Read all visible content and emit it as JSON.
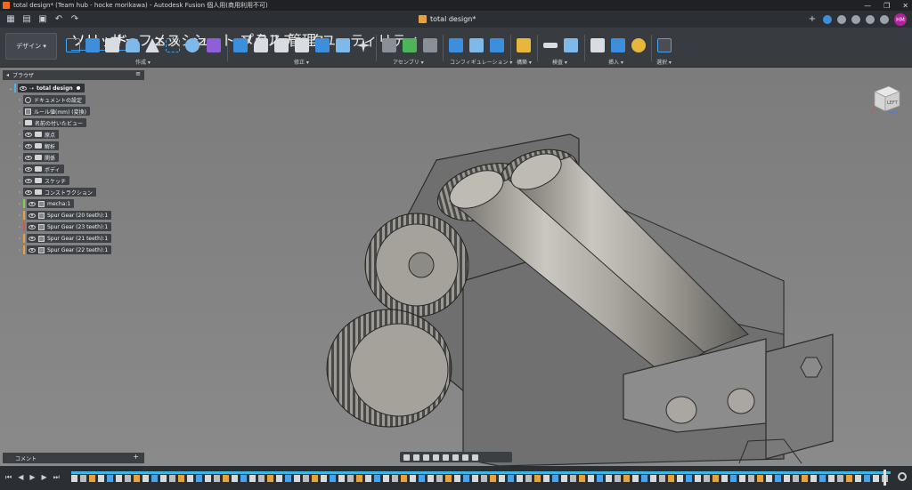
{
  "window": {
    "title": "total design* (Team hub - hocke morikawa) - Autodesk Fusion 個人用(商用利用不可)"
  },
  "document_tab": {
    "label": "total design*"
  },
  "user": {
    "initials": "HM",
    "avatar_color": "#b0249a"
  },
  "ribbon": {
    "workspace_label": "デザイン ▾",
    "tabs": [
      "ソリッド",
      "サーフェス",
      "メッシュ",
      "シート メタル",
      "プラスチック",
      "管理",
      "ユーティリティ"
    ],
    "active_tab": "ソリッド",
    "groups": [
      "作成 ▾",
      "修正 ▾",
      "アセンブリ ▾",
      "コンフィギュレーション ▾",
      "構築 ▾",
      "検査 ▾",
      "挿入 ▾",
      "選択 ▾"
    ]
  },
  "browser": {
    "title": "ブラウザ",
    "root": "total design",
    "items": [
      {
        "label": "ドキュメントの設定",
        "icon": "gear-icon"
      },
      {
        "label": "ルール値(mm) (変換)",
        "icon": "units-icon"
      },
      {
        "label": "名前の付いたビュー",
        "icon": "folder-icon"
      },
      {
        "label": "原点",
        "icon": "folder-icon"
      },
      {
        "label": "解析",
        "icon": "folder-icon"
      },
      {
        "label": "関係",
        "icon": "folder-icon"
      },
      {
        "label": "ボディ",
        "icon": "folder-icon"
      },
      {
        "label": "スケッチ",
        "icon": "folder-icon"
      },
      {
        "label": "コンストラクション",
        "icon": "folder-icon"
      },
      {
        "label": "mecha:1",
        "icon": "component-icon",
        "color": "#7fd34e"
      },
      {
        "label": "Spur Gear (20 teeth):1",
        "icon": "component-icon",
        "color": "#e8a13b"
      },
      {
        "label": "Spur Gear (23 teeth):1",
        "icon": "component-icon",
        "color": "#d9534f"
      },
      {
        "label": "Spur Gear (21 teeth):1",
        "icon": "component-icon",
        "color": "#e8a13b"
      },
      {
        "label": "Spur Gear (22 teeth):1",
        "icon": "component-icon",
        "color": "#e8a13b"
      }
    ]
  },
  "viewcube": {
    "face_label": "LEFT"
  },
  "comments": {
    "label": "コメント",
    "add": "+"
  },
  "timeline": {
    "controls": [
      "⏮",
      "◀",
      "▶",
      "▶",
      "⏭"
    ]
  },
  "window_controls": [
    "—",
    "❐",
    "✕"
  ]
}
